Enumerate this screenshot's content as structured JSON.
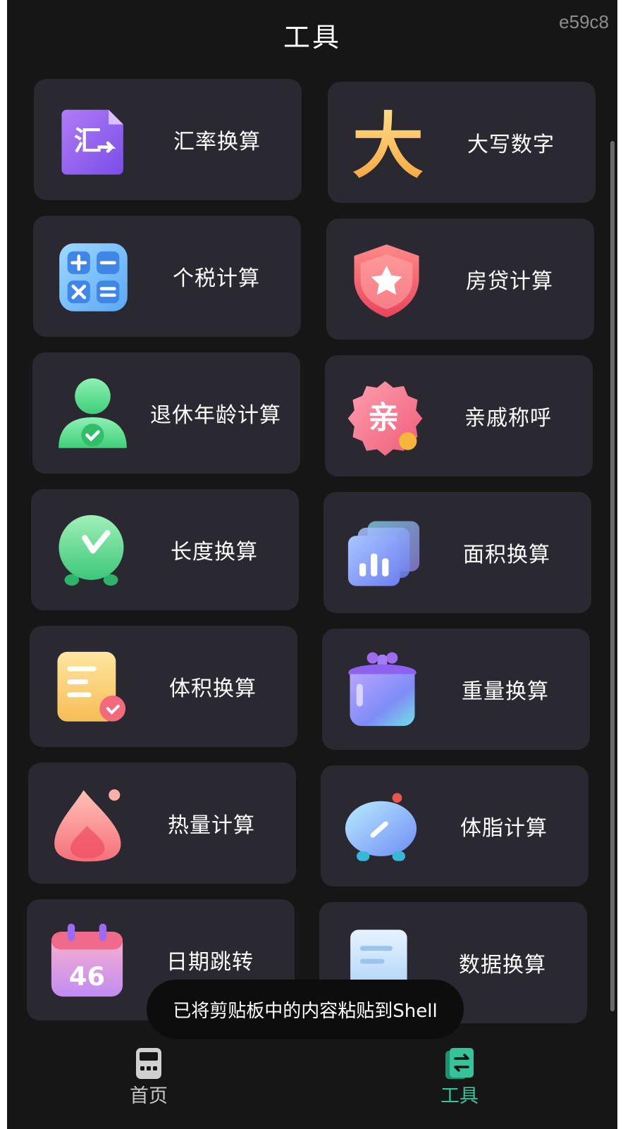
{
  "header": {
    "title": "工具",
    "device_code": "e59c8"
  },
  "tools": [
    {
      "label": "汇率换算",
      "icon": "exchange-rate-icon"
    },
    {
      "label": "大写数字",
      "icon": "capital-number-icon"
    },
    {
      "label": "个税计算",
      "icon": "calculator-icon"
    },
    {
      "label": "房贷计算",
      "icon": "shield-star-icon"
    },
    {
      "label": "退休年龄计算",
      "icon": "person-check-icon"
    },
    {
      "label": "亲戚称呼",
      "icon": "relative-badge-icon"
    },
    {
      "label": "长度换算",
      "icon": "clock-icon"
    },
    {
      "label": "面积换算",
      "icon": "bar-chart-cards-icon"
    },
    {
      "label": "体积换算",
      "icon": "document-heart-icon"
    },
    {
      "label": "重量换算",
      "icon": "jar-icon"
    },
    {
      "label": "热量计算",
      "icon": "flame-icon"
    },
    {
      "label": "体脂计算",
      "icon": "scale-icon"
    },
    {
      "label": "日期跳转",
      "icon": "calendar-icon"
    },
    {
      "label": "数据换算",
      "icon": "scroll-document-icon"
    }
  ],
  "icon_texts": {
    "exchange_rate": "汇",
    "capital_number": "大",
    "relative": "亲",
    "calendar_day": "46"
  },
  "toast": {
    "message": "已将剪贴板中的内容粘贴到Shell"
  },
  "bottom_nav": {
    "items": [
      {
        "label": "首页",
        "icon": "calculator-device-icon",
        "active": false
      },
      {
        "label": "工具",
        "icon": "swap-book-icon",
        "active": true
      }
    ],
    "active_color": "#36c39a"
  }
}
